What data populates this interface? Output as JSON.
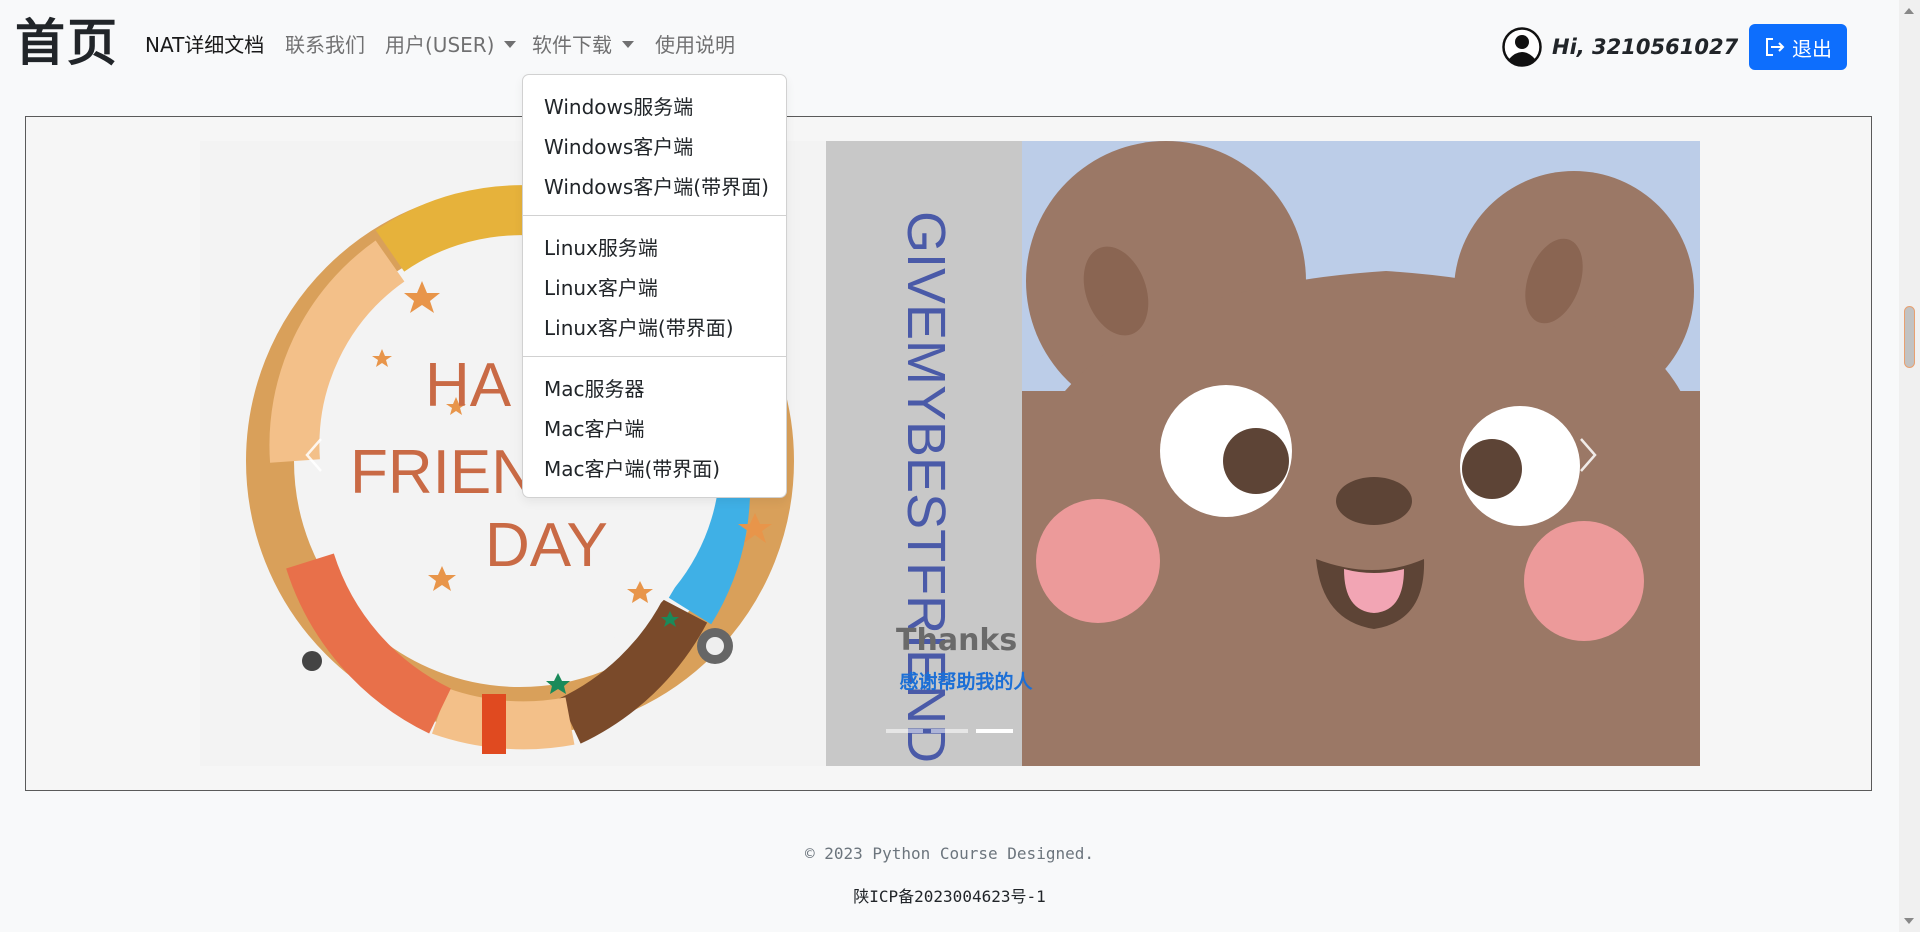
{
  "navbar": {
    "brand": "首页",
    "links": [
      "NAT详细文档",
      "联系我们",
      "用户(USER)",
      "软件下载",
      "使用说明"
    ],
    "user_greeting": "Hi, 3210561027",
    "logout_label": "退出"
  },
  "download_menu": {
    "groups": [
      [
        "Windows服务端",
        "Windows客户端",
        "Windows客户端(带界面)"
      ],
      [
        "Linux服务端",
        "Linux客户端",
        "Linux客户端(带界面)"
      ],
      [
        "Mac服务器",
        "Mac客户端",
        "Mac客户端(带界面)"
      ]
    ]
  },
  "carousel": {
    "left_image_text": [
      "HA",
      "FRIEN",
      "DAY"
    ],
    "right_image_text": "GIVEMYBESTFRIEND",
    "caption_title": "Thanks",
    "caption_subtitle": "感谢帮助我的人",
    "indicator_count": 3,
    "active_indicator": 3
  },
  "footer": {
    "copyright": "© 2023 Python Course Designed.",
    "icp": "陕ICP备2023004623号-1"
  },
  "colors": {
    "primary": "#0d6efd",
    "caption_blue": "#1c6fd6",
    "bear_brown": "#9b7866",
    "sky_blue": "#bccde8"
  }
}
